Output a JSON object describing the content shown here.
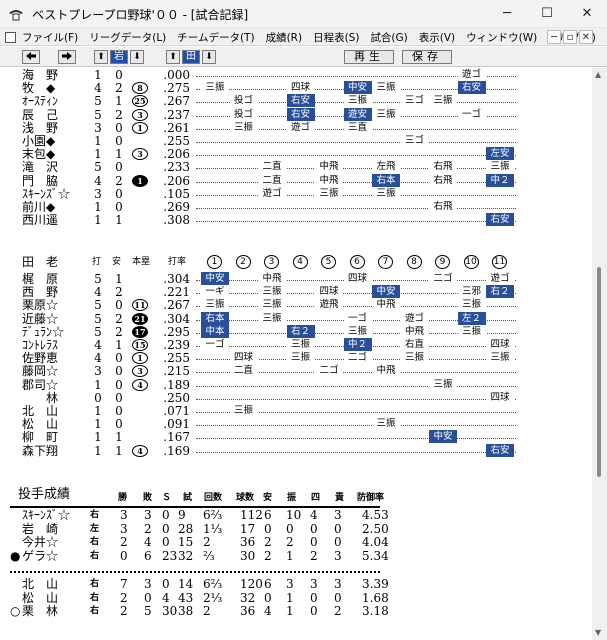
{
  "window": {
    "title": "ベストプレープロ野球'００ - [試合記録]",
    "minimize": "─",
    "maximize": "☐",
    "close": "✕"
  },
  "menu": {
    "items": [
      "ファイル(F)",
      "リーグデータ(L)",
      "チームデータ(T)",
      "成績(R)",
      "日程表(S)",
      "試合(G)",
      "表示(V)",
      "ウィンドウ(W)",
      "ヘルプ(H)"
    ],
    "mdi": [
      "─",
      "▫",
      "✕"
    ]
  },
  "toolbar": {
    "prev": "◆",
    "next": "➡",
    "team1_up": "⬆",
    "team1": "岩",
    "team1_down": "⬇",
    "team2_up": "⬆",
    "team2": "田",
    "team2_down": "⬇",
    "replay": "再生",
    "save": "保存"
  },
  "batting_top": [
    {
      "name": "海　野",
      "mark": "",
      "ab": "1",
      "h": "0",
      "hr": "",
      "avg": ".000",
      "results": [
        {
          "i": 10,
          "t": "遊ゴ",
          "hit": false
        }
      ]
    },
    {
      "name": "牧　◆",
      "mark": "",
      "ab": "4",
      "h": "2",
      "hr": "8",
      "hrfill": false,
      "avg": ".275",
      "results": [
        {
          "i": 1,
          "t": "三振",
          "hit": false
        },
        {
          "i": 4,
          "t": "四球",
          "hit": false
        },
        {
          "i": 6,
          "t": "中安",
          "hit": true
        },
        {
          "i": 7,
          "t": "三振",
          "hit": false
        },
        {
          "i": 10,
          "t": "右安",
          "hit": true
        }
      ]
    },
    {
      "name": "ｵｰｽﾃｨﾝ",
      "mark": "",
      "ab": "5",
      "h": "1",
      "hr": "25",
      "hrfill": false,
      "avg": ".267",
      "results": [
        {
          "i": 2,
          "t": "投ゴ",
          "hit": false
        },
        {
          "i": 4,
          "t": "右安",
          "hit": true
        },
        {
          "i": 6,
          "t": "三振",
          "hit": false
        },
        {
          "i": 8,
          "t": "三ゴ",
          "hit": false
        },
        {
          "i": 9,
          "t": "三振",
          "hit": false
        }
      ]
    },
    {
      "name": "辰　己",
      "mark": "",
      "ab": "5",
      "h": "2",
      "hr": "3",
      "hrfill": false,
      "avg": ".237",
      "results": [
        {
          "i": 2,
          "t": "投ゴ",
          "hit": false
        },
        {
          "i": 4,
          "t": "右安",
          "hit": true
        },
        {
          "i": 6,
          "t": "遊安",
          "hit": true
        },
        {
          "i": 7,
          "t": "三振",
          "hit": false
        },
        {
          "i": 10,
          "t": "一ゴ",
          "hit": false
        }
      ]
    },
    {
      "name": "浅　野",
      "mark": "",
      "ab": "3",
      "h": "0",
      "hr": "1",
      "hrfill": false,
      "avg": ".261",
      "results": [
        {
          "i": 2,
          "t": "三振",
          "hit": false
        },
        {
          "i": 4,
          "t": "遊ゴ",
          "hit": false
        },
        {
          "i": 6,
          "t": "三直",
          "hit": false
        }
      ]
    },
    {
      "name": "小園◆",
      "mark": "",
      "ab": "1",
      "h": "0",
      "hr": "",
      "avg": ".255",
      "results": [
        {
          "i": 8,
          "t": "三ゴ",
          "hit": false
        }
      ]
    },
    {
      "name": "末包◆",
      "mark": "",
      "ab": "1",
      "h": "1",
      "hr": "3",
      "hrfill": false,
      "avg": ".206",
      "results": [
        {
          "i": 11,
          "t": "左安",
          "hit": true
        }
      ]
    },
    {
      "name": "滝　沢",
      "mark": "",
      "ab": "5",
      "h": "0",
      "hr": "",
      "avg": ".233",
      "results": [
        {
          "i": 3,
          "t": "二直",
          "hit": false
        },
        {
          "i": 5,
          "t": "中飛",
          "hit": false
        },
        {
          "i": 7,
          "t": "左飛",
          "hit": false
        },
        {
          "i": 9,
          "t": "右飛",
          "hit": false
        },
        {
          "i": 11,
          "t": "三振",
          "hit": false
        }
      ]
    },
    {
      "name": "門　脇",
      "mark": "",
      "ab": "4",
      "h": "2",
      "hr": "1",
      "hrfill": true,
      "avg": ".206",
      "results": [
        {
          "i": 3,
          "t": "二直",
          "hit": false
        },
        {
          "i": 5,
          "t": "中飛",
          "hit": false
        },
        {
          "i": 7,
          "t": "右本",
          "hit": true
        },
        {
          "i": 9,
          "t": "右飛",
          "hit": false
        },
        {
          "i": 11,
          "t": "中２",
          "hit": true
        }
      ]
    },
    {
      "name": "ｽｷｰﾝｽﾞ☆",
      "mark": "",
      "ab": "3",
      "h": "0",
      "hr": "",
      "avg": ".105",
      "results": [
        {
          "i": 3,
          "t": "遊ゴ",
          "hit": false
        },
        {
          "i": 5,
          "t": "三振",
          "hit": false
        },
        {
          "i": 7,
          "t": "三振",
          "hit": false
        }
      ]
    },
    {
      "name": "前川◆",
      "mark": "",
      "ab": "1",
      "h": "0",
      "hr": "",
      "avg": ".269",
      "results": [
        {
          "i": 9,
          "t": "右飛",
          "hit": false
        }
      ]
    },
    {
      "name": "西川遥",
      "mark": "",
      "ab": "1",
      "h": "1",
      "hr": "",
      "avg": ".308",
      "results": [
        {
          "i": 11,
          "t": "右安",
          "hit": true
        }
      ]
    }
  ],
  "header2": {
    "team": "田　老",
    "ab": "打",
    "h": "安",
    "hr": "本塁",
    "avg": "打率",
    "innings": [
      "1",
      "2",
      "3",
      "4",
      "5",
      "6",
      "7",
      "8",
      "9",
      "10",
      "11"
    ]
  },
  "batting_bottom": [
    {
      "name": "梶　原",
      "ab": "5",
      "h": "1",
      "hr": "",
      "avg": ".304",
      "results": [
        {
          "i": 1,
          "t": "中安",
          "hit": true
        },
        {
          "i": 3,
          "t": "中飛",
          "hit": false
        },
        {
          "i": 6,
          "t": "四球",
          "hit": false
        },
        {
          "i": 9,
          "t": "二ゴ",
          "hit": false
        },
        {
          "i": 11,
          "t": "遊ゴ",
          "hit": false
        }
      ]
    },
    {
      "name": "西　野",
      "ab": "4",
      "h": "2",
      "hr": "",
      "avg": ".221",
      "results": [
        {
          "i": 1,
          "t": "一ギ",
          "hit": false
        },
        {
          "i": 3,
          "t": "三振",
          "hit": false
        },
        {
          "i": 5,
          "t": "四球",
          "hit": false
        },
        {
          "i": 7,
          "t": "中安",
          "hit": true
        },
        {
          "i": 10,
          "t": "三邪",
          "hit": false
        },
        {
          "i": 11,
          "t": "右２",
          "hit": true
        }
      ]
    },
    {
      "name": "栗原☆",
      "ab": "5",
      "h": "0",
      "hr": "11",
      "hrfill": false,
      "avg": ".267",
      "results": [
        {
          "i": 1,
          "t": "三振",
          "hit": false
        },
        {
          "i": 3,
          "t": "三振",
          "hit": false
        },
        {
          "i": 5,
          "t": "遊飛",
          "hit": false
        },
        {
          "i": 7,
          "t": "中飛",
          "hit": false
        },
        {
          "i": 10,
          "t": "三振",
          "hit": false
        }
      ]
    },
    {
      "name": "近藤☆",
      "ab": "5",
      "h": "2",
      "hr": "21",
      "hrfill": true,
      "avg": ".304",
      "results": [
        {
          "i": 1,
          "t": "右本",
          "hit": true
        },
        {
          "i": 3,
          "t": "三振",
          "hit": false
        },
        {
          "i": 6,
          "t": "一ゴ",
          "hit": false
        },
        {
          "i": 8,
          "t": "遊ゴ",
          "hit": false
        },
        {
          "i": 10,
          "t": "左２",
          "hit": true
        }
      ]
    },
    {
      "name": "ﾃﾞｭﾗﾝ☆",
      "ab": "5",
      "h": "2",
      "hr": "17",
      "hrfill": true,
      "avg": ".295",
      "results": [
        {
          "i": 1,
          "t": "中本",
          "hit": true
        },
        {
          "i": 4,
          "t": "右２",
          "hit": true
        },
        {
          "i": 6,
          "t": "三振",
          "hit": false
        },
        {
          "i": 8,
          "t": "中飛",
          "hit": false
        },
        {
          "i": 10,
          "t": "三振",
          "hit": false
        }
      ]
    },
    {
      "name": "ｺﾝﾄﾚﾗｽ",
      "ab": "4",
      "h": "1",
      "hr": "15",
      "hrfill": false,
      "avg": ".239",
      "results": [
        {
          "i": 1,
          "t": "一ゴ",
          "hit": false
        },
        {
          "i": 4,
          "t": "三振",
          "hit": false
        },
        {
          "i": 6,
          "t": "中２",
          "hit": true
        },
        {
          "i": 8,
          "t": "右直",
          "hit": false
        },
        {
          "i": 11,
          "t": "四球",
          "hit": false
        }
      ]
    },
    {
      "name": "佐野恵",
      "ab": "4",
      "h": "0",
      "hr": "1",
      "hrfill": false,
      "avg": ".255",
      "results": [
        {
          "i": 2,
          "t": "四球",
          "hit": false
        },
        {
          "i": 4,
          "t": "三振",
          "hit": false
        },
        {
          "i": 6,
          "t": "二ゴ",
          "hit": false
        },
        {
          "i": 8,
          "t": "三振",
          "hit": false
        },
        {
          "i": 11,
          "t": "三振",
          "hit": false
        }
      ]
    },
    {
      "name": "藤岡☆",
      "ab": "3",
      "h": "0",
      "hr": "3",
      "hrfill": false,
      "avg": ".215",
      "results": [
        {
          "i": 2,
          "t": "二直",
          "hit": false
        },
        {
          "i": 5,
          "t": "二ゴ",
          "hit": false
        },
        {
          "i": 7,
          "t": "中飛",
          "hit": false
        }
      ]
    },
    {
      "name": "郡司☆",
      "ab": "1",
      "h": "0",
      "hr": "4",
      "hrfill": false,
      "avg": ".189",
      "results": [
        {
          "i": 9,
          "t": "三振",
          "hit": false
        }
      ]
    },
    {
      "name": "　　林",
      "ab": "0",
      "h": "0",
      "hr": "",
      "avg": ".250",
      "results": [
        {
          "i": 11,
          "t": "四球",
          "hit": false
        }
      ]
    },
    {
      "name": "北　山",
      "ab": "1",
      "h": "0",
      "hr": "",
      "avg": ".071",
      "results": [
        {
          "i": 2,
          "t": "三振",
          "hit": false
        }
      ]
    },
    {
      "name": "松　山",
      "ab": "1",
      "h": "0",
      "hr": "",
      "avg": ".091",
      "results": [
        {
          "i": 7,
          "t": "三振",
          "hit": false
        }
      ]
    },
    {
      "name": "柳　町",
      "ab": "1",
      "h": "1",
      "hr": "",
      "avg": ".167",
      "results": [
        {
          "i": 9,
          "t": "中安",
          "hit": true
        }
      ]
    },
    {
      "name": "森下翔",
      "ab": "1",
      "h": "1",
      "hr": "4",
      "hrfill": false,
      "avg": ".169",
      "results": [
        {
          "i": 11,
          "t": "右安",
          "hit": true
        }
      ]
    }
  ],
  "pitching": {
    "title": "投手成績",
    "headers": [
      "勝",
      "敗",
      "Ｓ",
      "試",
      "回数",
      "球数",
      "安",
      "振",
      "四",
      "責",
      "防御率"
    ],
    "rows_a": [
      {
        "name": "ｽｷｰﾝｽﾞ☆",
        "prefix": "",
        "hand": "右",
        "w": "3",
        "l": "3",
        "s": "0",
        "g": "9",
        "ip": "6⅔",
        "np": "112",
        "h": "6",
        "k": "10",
        "bb": "4",
        "er": "3",
        "era": "4.53"
      },
      {
        "name": "岩　崎",
        "prefix": "",
        "hand": "左",
        "w": "3",
        "l": "2",
        "s": "0",
        "g": "28",
        "ip": "1⅓",
        "np": "17",
        "h": "0",
        "k": "0",
        "bb": "0",
        "er": "0",
        "era": "2.50"
      },
      {
        "name": "今井☆",
        "prefix": "",
        "hand": "右",
        "w": "2",
        "l": "4",
        "s": "0",
        "g": "15",
        "ip": "2",
        "np": "36",
        "h": "2",
        "k": "2",
        "bb": "0",
        "er": "0",
        "era": "4.04"
      },
      {
        "name": "ゲラ☆",
        "prefix": "●",
        "hand": "右",
        "w": "0",
        "l": "6",
        "s": "23",
        "g": "32",
        "ip": "⅔",
        "np": "30",
        "h": "2",
        "k": "1",
        "bb": "2",
        "er": "3",
        "era": "5.34"
      }
    ],
    "rows_b": [
      {
        "name": "北　山",
        "prefix": "",
        "hand": "右",
        "w": "7",
        "l": "3",
        "s": "0",
        "g": "14",
        "ip": "6⅔",
        "np": "120",
        "h": "6",
        "k": "3",
        "bb": "3",
        "er": "3",
        "era": "3.39"
      },
      {
        "name": "松　山",
        "prefix": "",
        "hand": "右",
        "w": "2",
        "l": "0",
        "s": "4",
        "g": "43",
        "ip": "2⅓",
        "np": "32",
        "h": "0",
        "k": "1",
        "bb": "0",
        "er": "0",
        "era": "1.68"
      },
      {
        "name": "栗　林",
        "prefix": "○",
        "hand": "右",
        "w": "2",
        "l": "5",
        "s": "30",
        "g": "38",
        "ip": "2",
        "np": "36",
        "h": "4",
        "k": "1",
        "bb": "0",
        "er": "2",
        "era": "3.18"
      }
    ]
  },
  "colors": {
    "hit": "#2a4f9a",
    "selected": "#1f4fa8"
  }
}
